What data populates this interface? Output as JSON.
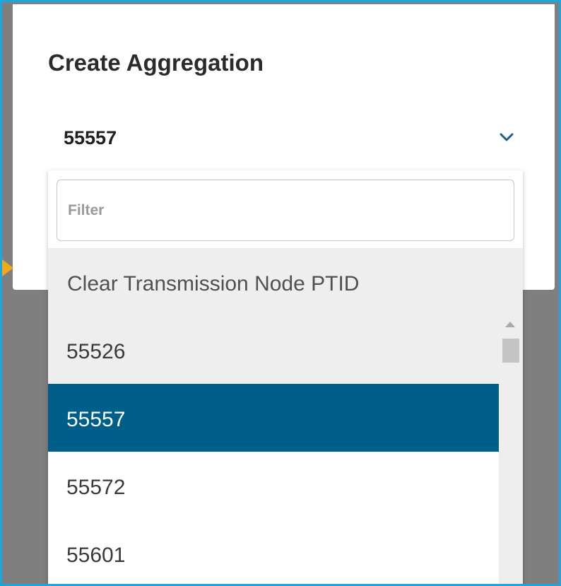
{
  "dialog": {
    "title": "Create Aggregation"
  },
  "select": {
    "value": "55557",
    "icon": "chevron-down-icon"
  },
  "filter": {
    "placeholder": "Filter",
    "value": ""
  },
  "clear_option": {
    "label": "Clear Transmission Node PTID"
  },
  "options": [
    {
      "label": "55526",
      "state": "hover"
    },
    {
      "label": "55557",
      "state": "selected"
    },
    {
      "label": "55572",
      "state": "normal"
    },
    {
      "label": "55601",
      "state": "normal"
    }
  ],
  "colors": {
    "frame_border": "#1aa7e0",
    "selected_background": "#005f89",
    "overlay": "#7f7f7f",
    "pointer_marker": "#f0a81d"
  }
}
